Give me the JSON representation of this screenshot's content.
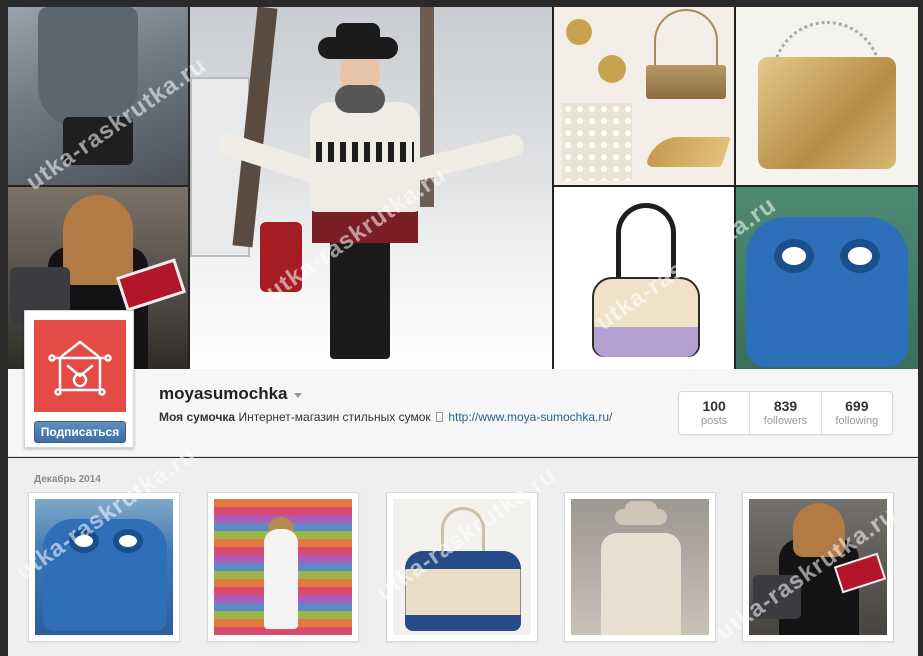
{
  "profile": {
    "username": "moyasumochka",
    "display_name": "Моя сумочка",
    "bio_text": "Интернет-магазин стильных сумок",
    "link": "http://www.moya-sumochka.ru/",
    "subscribe_label": "Подписаться",
    "avatar_color": "#e44b47"
  },
  "stats": [
    {
      "value": "100",
      "label": "posts"
    },
    {
      "value": "839",
      "label": "followers"
    },
    {
      "value": "699",
      "label": "following"
    }
  ],
  "feed": {
    "section_date": "Декабрь 2014"
  },
  "watermark": {
    "text": "utka-raskrutka.ru"
  },
  "colors": {
    "accent_link": "#2d5f8f",
    "button_blue": "#3f6fa3"
  }
}
